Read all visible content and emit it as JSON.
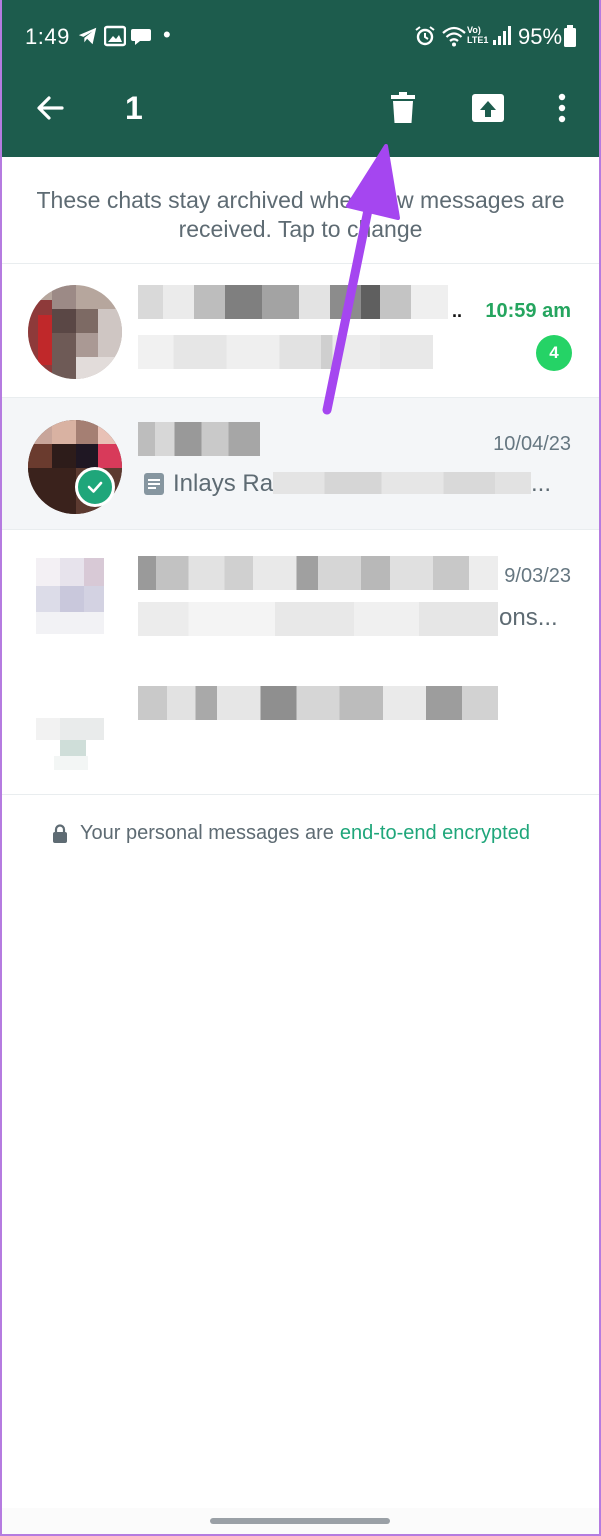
{
  "status_bar": {
    "time": "1:49",
    "dot": "•",
    "network": "Vo) LTE1",
    "battery": "95%"
  },
  "app_bar": {
    "selected_count": "1",
    "icons": [
      "back-arrow-icon",
      "trash-icon",
      "unarchive-icon",
      "more-vert-icon"
    ]
  },
  "info_text": "These chats stay archived when new messages are received. Tap to change",
  "chats": [
    {
      "name": "",
      "time": "10:59 am",
      "unread_count": "4",
      "preview": "",
      "selected": false
    },
    {
      "name": "",
      "time": "10/04/23",
      "preview": "Inlays Ra",
      "preview_suffix": "...",
      "selected": true
    },
    {
      "name": "",
      "time": "9/03/23",
      "preview": "ons...",
      "selected": false
    },
    {
      "name": "",
      "time": "",
      "preview": "",
      "selected": false
    }
  ],
  "encryption_note": {
    "text": "Your personal messages are",
    "link": "end-to-end encrypted"
  },
  "colors": {
    "app_bar": "#1d5c4d",
    "accent_green": "#25d366",
    "link_green": "#1fa67a",
    "annotation_arrow": "#a546f0"
  }
}
